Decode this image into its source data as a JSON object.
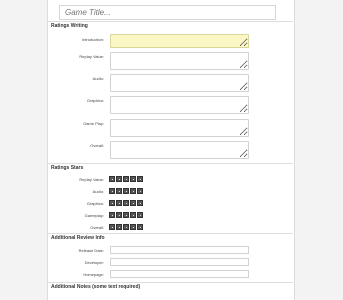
{
  "title_input": {
    "placeholder": "Game Title..."
  },
  "sections": {
    "writing": "Ratings Writing",
    "stars": "Ratings Stars",
    "review": "Additional Review Info",
    "notes": "Additional Notes (some text required)"
  },
  "writing_fields": [
    {
      "label": "Introduction:"
    },
    {
      "label": "Replay Value:"
    },
    {
      "label": "Audio:"
    },
    {
      "label": "Graphics:"
    },
    {
      "label": "Game Play:"
    },
    {
      "label": "Overall:"
    }
  ],
  "star_fields": [
    {
      "label": "Replay Value:"
    },
    {
      "label": "Audio:"
    },
    {
      "label": "Graphics:"
    },
    {
      "label": "Gameplay:"
    },
    {
      "label": "Overall:"
    }
  ],
  "review_fields": [
    {
      "label": "Release Date:"
    },
    {
      "label": "Developer:"
    },
    {
      "label": "Homepage:"
    }
  ],
  "colors": {
    "highlight_field": "#fbf7c4",
    "title_text": "#b33a3a"
  }
}
